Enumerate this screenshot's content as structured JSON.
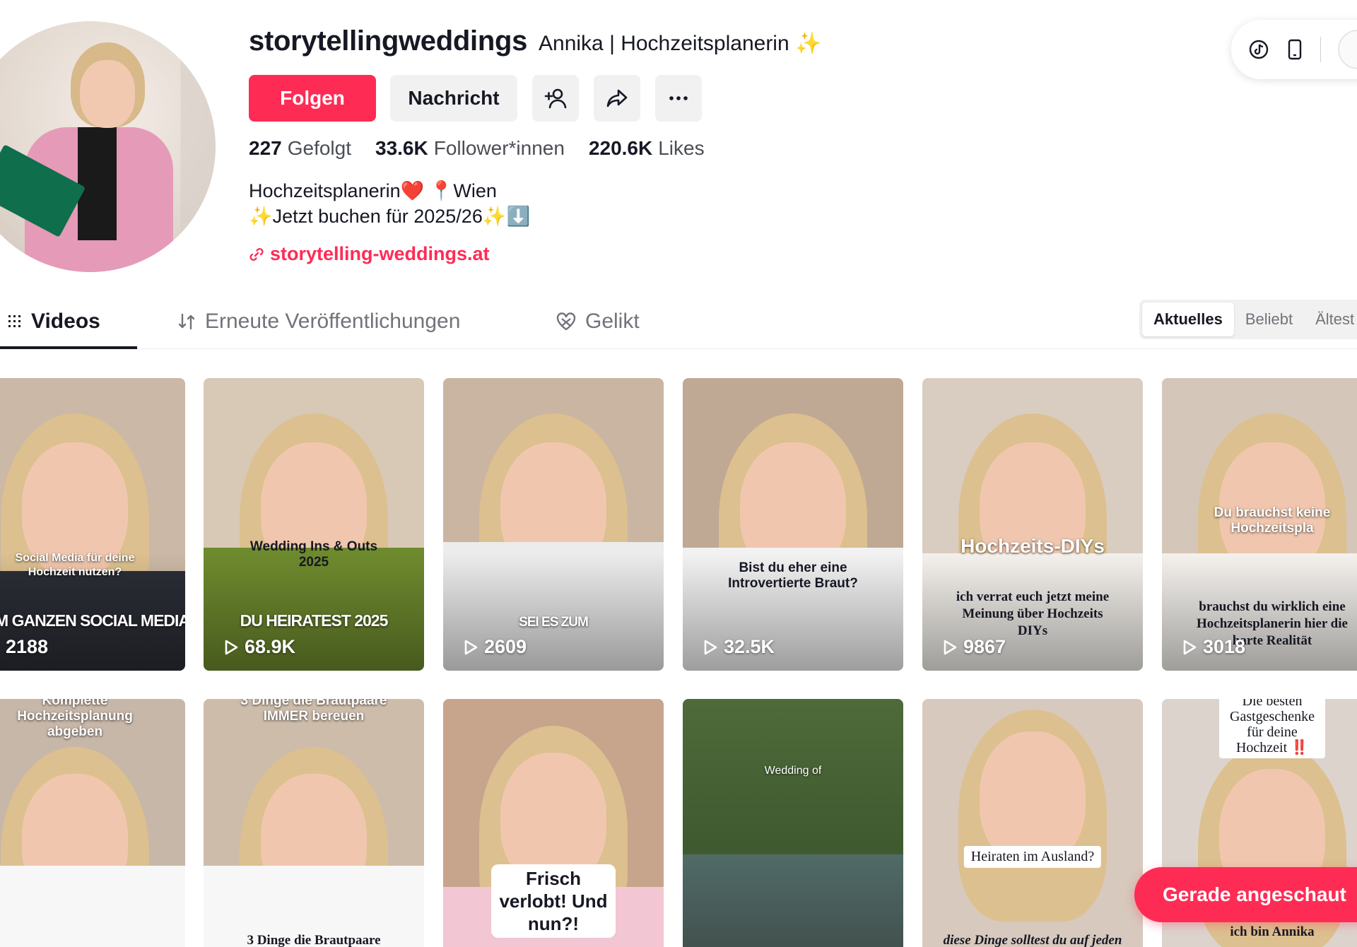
{
  "profile": {
    "username": "storytellingweddings",
    "nickname": "Annika | Hochzeitsplanerin",
    "nickname_emoji": "✨",
    "follow_label": "Folgen",
    "message_label": "Nachricht",
    "stats": [
      {
        "value": "227",
        "label": "Gefolgt"
      },
      {
        "value": "33.6K",
        "label": "Follower*innen"
      },
      {
        "value": "220.6K",
        "label": "Likes"
      }
    ],
    "bio_line1": "Hochzeitsplanerin❤️ 📍Wien",
    "bio_line2": "✨Jetzt buchen für 2025/26✨⬇️",
    "link": "storytelling-weddings.at",
    "icons": [
      "add-friend-icon",
      "share-icon",
      "more-icon",
      "link-icon"
    ]
  },
  "app_pill": {
    "icons": [
      "tiktok-icon",
      "phone-icon"
    ]
  },
  "tabs": {
    "videos": "Videos",
    "reposts": "Erneute Veröffentlichungen",
    "liked": "Gelikt"
  },
  "sort": {
    "options": [
      "Aktuelles",
      "Beliebt",
      "Ältest"
    ],
    "selected": "Aktuelles"
  },
  "videos_row1": [
    {
      "caption_top": "Social Media für deine Hochzeit nutzen?",
      "caption_bottom": "ESEM GANZEN SOCIAL MEDIA",
      "views": "2188"
    },
    {
      "caption_top": "Wedding Ins & Outs 2025",
      "caption_bottom": "DU HEIRATEST 2025",
      "views": "68.9K"
    },
    {
      "caption_top": "",
      "caption_bottom": "SEI ES ZUM",
      "views": "2609"
    },
    {
      "caption_top": "Bist du eher eine Introvertierte Braut?",
      "caption_bottom": "",
      "views": "32.5K"
    },
    {
      "caption_top": "Hochzeits-DIYs",
      "caption_bottom": "ich verrat euch jetzt meine Meinung über Hochzeits DIYs",
      "views": "9867"
    },
    {
      "caption_top": "Du brauchst keine Hochzeitspla",
      "caption_bottom": "brauchst du wirklich eine Hochzeitsplanerin hier die harte Realität",
      "views": "3018"
    }
  ],
  "videos_row2": [
    {
      "caption_top": "Komplette Hochzeitsplanung abgeben",
      "caption_bottom": ""
    },
    {
      "caption_top": "3 Dinge die Brautpaare IMMER bereuen",
      "caption_bottom": "3 Dinge die Brautpaare"
    },
    {
      "caption_top": "",
      "caption_bottom": "Frisch verlobt! Und nun?!"
    },
    {
      "caption_top": "Wedding of",
      "caption_bottom": ""
    },
    {
      "caption_top": "Heiraten im Ausland?",
      "caption_bottom": "diese Dinge solltest du auf jeden"
    },
    {
      "caption_top": "Die besten Gastgeschenke für deine Hochzeit ‼️",
      "caption_bottom": "ich bin Annika"
    }
  ],
  "toast": {
    "label": "Gerade angeschaut"
  },
  "colors": {
    "accent": "#fe2c55",
    "text": "#161823",
    "muted": "#72737a",
    "button_bg": "#f1f1f2"
  }
}
